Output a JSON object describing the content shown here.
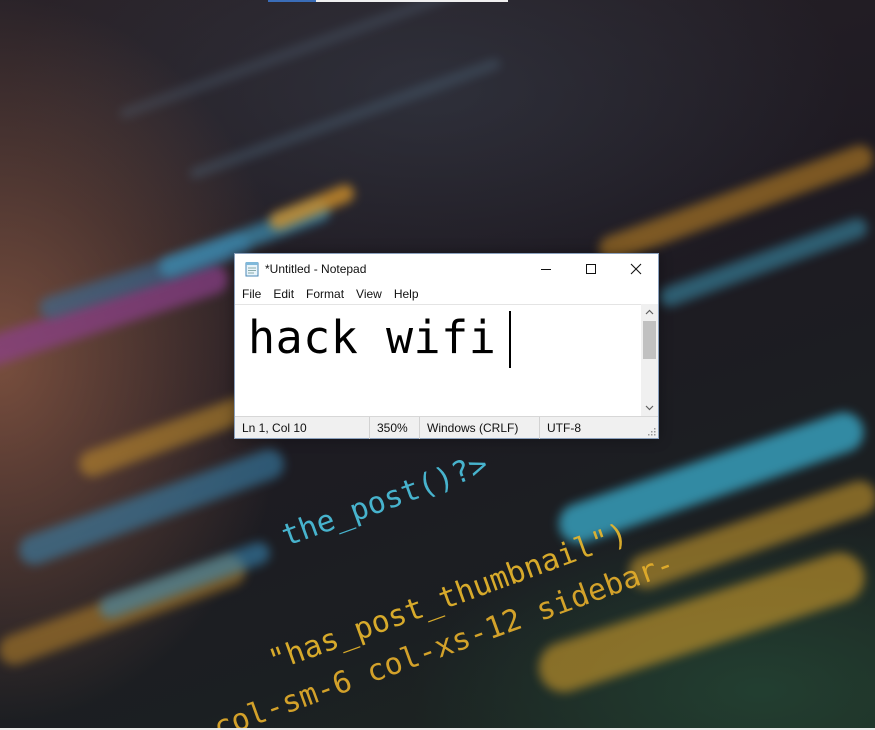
{
  "desktop": {
    "wallpaper_code": [
      "the_post()?>",
      "\"has_post_thumbnail\")",
      "col-sm-6 col-xs-12 sidebar-"
    ]
  },
  "window": {
    "title": "*Untitled - Notepad",
    "icon": "notepad-icon",
    "controls": {
      "minimize": "minimize-icon",
      "maximize": "maximize-icon",
      "close": "close-icon"
    }
  },
  "menu": [
    "File",
    "Edit",
    "Format",
    "View",
    "Help"
  ],
  "editor": {
    "content": "hack wifi"
  },
  "status": {
    "position": "Ln 1, Col 10",
    "zoom": "350%",
    "line_ending": "Windows (CRLF)",
    "encoding": "UTF-8"
  },
  "colors": {
    "code_cyan": "#3fb8d8",
    "code_yellow": "#e6b52c",
    "window_border": "#8aa0bd"
  }
}
